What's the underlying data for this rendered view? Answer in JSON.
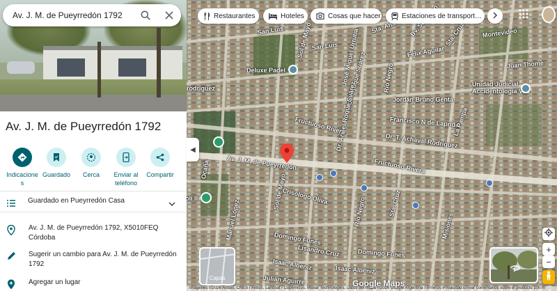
{
  "search": {
    "query": "Av. J. M. de Pueyrredón 1792"
  },
  "place": {
    "title": "Av. J. M. de Pueyrredón 1792"
  },
  "actions": [
    {
      "label": "Indicacione\ns"
    },
    {
      "label": "Guardado"
    },
    {
      "label": "Cerca"
    },
    {
      "label": "Enviar al teléfono"
    },
    {
      "label": "Compartir"
    }
  ],
  "saved_row": {
    "label": "Guardado en Pueyrredón Casa"
  },
  "info": {
    "address_line1": "Av. J. M. de Pueyrredón 1792, X5010FEQ",
    "address_line2": "Córdoba",
    "suggest_line1": "Sugerir un cambio para Av. J. M. de Pueyrredón",
    "suggest_line2": "1792",
    "add_place": "Agregar un lugar"
  },
  "chips": [
    {
      "label": "Restaurantes",
      "icon": "fork-knife-icon"
    },
    {
      "label": "Hoteles",
      "icon": "bed-icon"
    },
    {
      "label": "Cosas que hacer",
      "icon": "camera-icon"
    },
    {
      "label": "Estaciones de transport…",
      "icon": "transit-icon"
    }
  ],
  "map": {
    "labels": {
      "san_luis_1": "San Luis",
      "san_luis_2": "San Luis",
      "sol_de_mayo_top": "Sol de Mayo",
      "jose_miguel_urrutia": "José Miguel Urrutia",
      "rio_negro_top": "Río Negro",
      "sta_ana": "Sta. Ana",
      "felix_aguilar": "Félix Aguilar",
      "bv_san_juan": "Bv. San Juan",
      "montevideo": "Montevideo",
      "juan_thome": "Juan Thome",
      "sta_cruz": "Sta. Cruz",
      "deluxe_padel": "Deluxe Padel",
      "jose_roque_suarez": "José Roque Suárez",
      "jordan_bruno_genta": "Jordán Bruno Genta",
      "unidad_judicial": "Unidad Judicial\nAccidentología Vial",
      "rodriguez": "rodriguez",
      "dr_angel_roque_suarez": "Dr. Ángel Roque Suárez",
      "francisco_laprida": "Francisco N de Laprida",
      "la_pampa": "La Pampa",
      "fructuoso_1": "Fructuoso Rivera",
      "fructuoso_2": "Fructuoso Rivera",
      "dr_achaval": "Dr. T. Achaval Rodriguez",
      "pueyrredon": "Av. J. M. de Pueyrredón",
      "ocana": "Ocaña",
      "sol_de_mayo_mid": "Sol de Mayo",
      "crisologo_oliva": "Crisólogo Oliva",
      "rio_negro_mid": "Río Negro",
      "sta_cruz_mid": "Sta. Cruz",
      "misiones": "Misiones",
      "manuel_lopez": "Manuel López",
      "domingo_funes_1": "Domingo Funes",
      "domingo_funes_2": "Domingo Funes",
      "lisandro_1": "Lisandro Cruz",
      "sol_de_mayo_low": "Sol de Mayo",
      "oli_ii": "oli II",
      "isaac_albeniz_1": "Isaac Albeniz",
      "isaac_albeniz_2": "Isaac Albeniz",
      "julian_aguirre": "Julián Aguirre"
    },
    "layers_label": "Capas",
    "google": "Google Maps",
    "footer": "Imágenes ©2026 Airbus, CNES / Airbus, Landsat / Copernicus, Maxar Technologies, Datos del mapa ©2026 Google   Argentina   Términos   Privacidad   Enviar comentarios sobre el producto   100 m"
  }
}
